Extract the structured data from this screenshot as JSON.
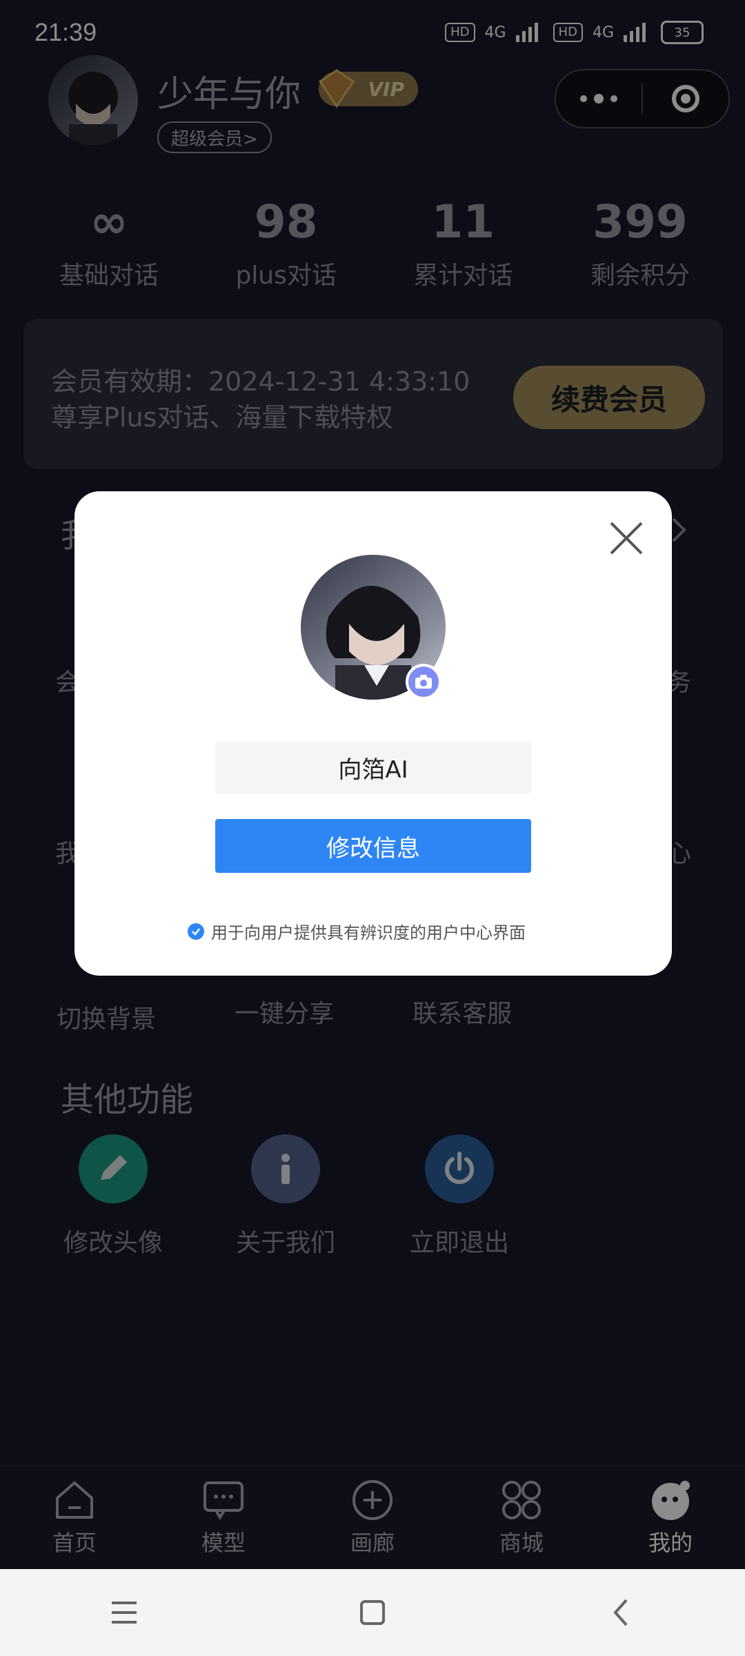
{
  "status_bar": {
    "time": "21:39",
    "network_1": "4G",
    "network_2": "4G",
    "hd_1": "HD",
    "hd_2": "HD",
    "battery": "35"
  },
  "profile": {
    "username": "少年与你",
    "vip_label": "VIP",
    "super_member_label": "超级会员>"
  },
  "stats": [
    {
      "value": "∞",
      "label": "基础对话"
    },
    {
      "value": "98",
      "label": "plus对话"
    },
    {
      "value": "11",
      "label": "累计对话"
    },
    {
      "value": "399",
      "label": "剩余积分"
    }
  ],
  "membership": {
    "expiry": "会员有效期：2024-12-31 4:33:10",
    "perk": "尊享Plus对话、海量下载特权",
    "renew_label": "续费会员"
  },
  "background_grid": {
    "partial_1": "我",
    "partial_2": "会",
    "partial_3": "务",
    "partial_4": "我",
    "partial_5": "心",
    "row3": [
      "切换背景",
      "一键分享",
      "联系客服"
    ]
  },
  "other_functions": {
    "title": "其他功能",
    "items": [
      {
        "label": "修改头像",
        "icon": "pencil-icon",
        "color": "#1a9a86"
      },
      {
        "label": "关于我们",
        "icon": "info-icon",
        "color": "#55648e"
      },
      {
        "label": "立即退出",
        "icon": "power-icon",
        "color": "#2d5f9c"
      }
    ]
  },
  "tabbar": {
    "items": [
      {
        "label": "首页",
        "icon": "home-icon"
      },
      {
        "label": "模型",
        "icon": "chat-icon"
      },
      {
        "label": "画廊",
        "icon": "add-circle-icon"
      },
      {
        "label": "商城",
        "icon": "grid-icon"
      },
      {
        "label": "我的",
        "icon": "mascot-icon",
        "active": true
      }
    ]
  },
  "modal": {
    "name_value": "向箔AI",
    "save_label": "修改信息",
    "note": "用于向用户提供具有辨识度的用户中心界面"
  },
  "colors": {
    "accent_blue": "#2e86f5",
    "gold": "#a28c5a",
    "background": "#16182a"
  }
}
